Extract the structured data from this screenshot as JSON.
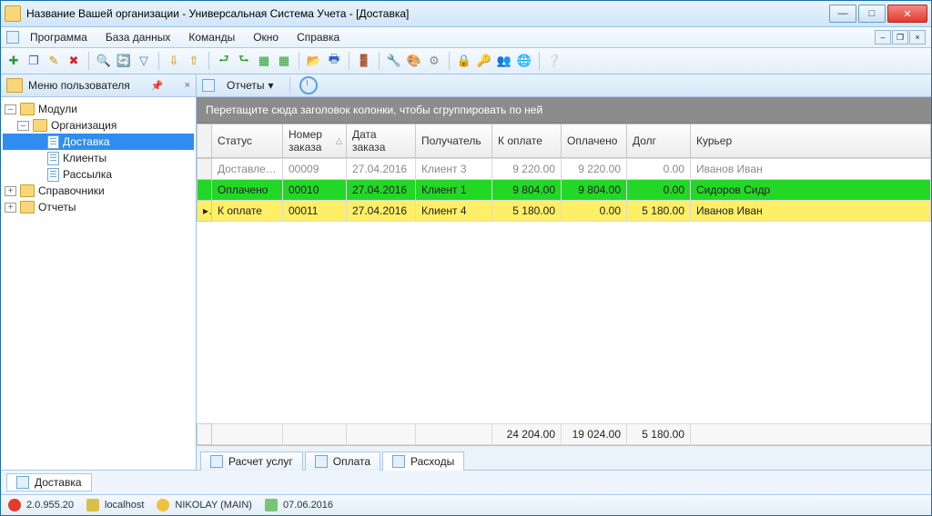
{
  "title": "Название Вашей организации - Универсальная Система Учета - [Доставка]",
  "menu": {
    "program": "Программа",
    "db": "База данных",
    "teams": "Команды",
    "window": "Окно",
    "help": "Справка"
  },
  "sidebar": {
    "header": "Меню пользователя",
    "nodes": {
      "modules": "Модули",
      "organization": "Организация",
      "delivery": "Доставка",
      "clients": "Клиенты",
      "mailing": "Рассылка",
      "directories": "Справочники",
      "reports": "Отчеты"
    }
  },
  "subtoolbar": {
    "reports": "Отчеты"
  },
  "groupHint": "Перетащите сюда заголовок колонки, чтобы сгруппировать по ней",
  "columns": {
    "status": "Статус",
    "orderNo": "Номер заказа",
    "orderDate": "Дата заказа",
    "recipient": "Получатель",
    "toPay": "К оплате",
    "paid": "Оплачено",
    "debt": "Долг",
    "courier": "Курьер"
  },
  "rows": [
    {
      "class": "r-delivered",
      "status": "Доставлено",
      "no": "00009",
      "date": "27.04.2016",
      "recipient": "Клиент 3",
      "toPay": "9 220.00",
      "paid": "9 220.00",
      "debt": "0.00",
      "courier": "Иванов Иван",
      "current": false
    },
    {
      "class": "r-paid",
      "status": "Оплачено",
      "no": "00010",
      "date": "27.04.2016",
      "recipient": "Клиент 1",
      "toPay": "9 804.00",
      "paid": "9 804.00",
      "debt": "0.00",
      "courier": "Сидоров Сидр",
      "current": false
    },
    {
      "class": "r-topay",
      "status": "К оплате",
      "no": "00011",
      "date": "27.04.2016",
      "recipient": "Клиент 4",
      "toPay": "5 180.00",
      "paid": "0.00",
      "debt": "5 180.00",
      "courier": "Иванов Иван",
      "current": true
    }
  ],
  "totals": {
    "toPay": "24 204.00",
    "paid": "19 024.00",
    "debt": "5 180.00"
  },
  "bottomTabs": {
    "services": "Расчет услуг",
    "payment": "Оплата",
    "expenses": "Расходы"
  },
  "windowTab": "Доставка",
  "status": {
    "version": "2.0.955.20",
    "host": "localhost",
    "user": "NIKOLAY (MAIN)",
    "date": "07.06.2016"
  }
}
